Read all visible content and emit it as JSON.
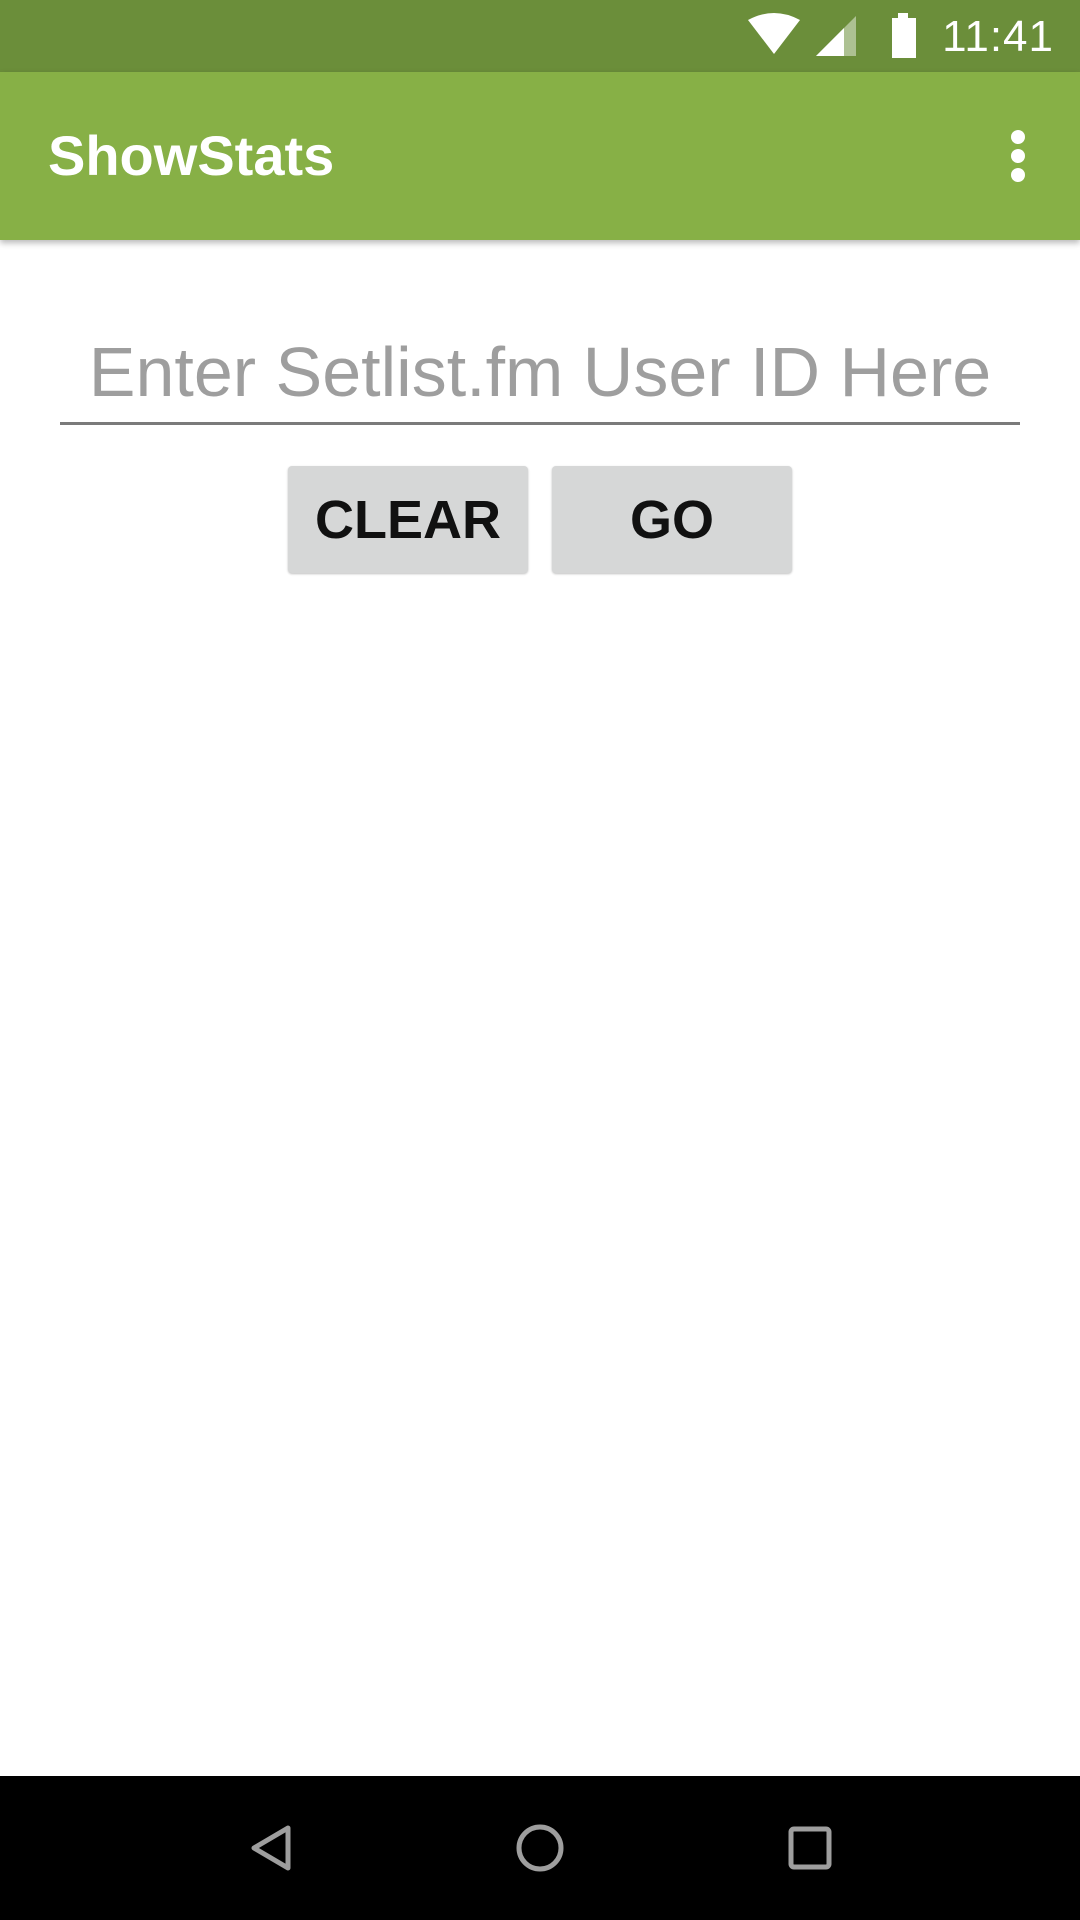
{
  "status_bar": {
    "time": "11:41",
    "icons": [
      "wifi-icon",
      "cell-signal-icon",
      "battery-icon"
    ]
  },
  "app_bar": {
    "title": "ShowStats",
    "menu_icon": "more-vert-icon"
  },
  "form": {
    "user_id_placeholder": "Enter Setlist.fm User ID Here",
    "user_id_value": "",
    "clear_label": "CLEAR",
    "go_label": "GO"
  },
  "nav_bar": {
    "icons": [
      "back-icon",
      "home-icon",
      "recents-icon"
    ]
  },
  "colors": {
    "status_bar": "#6b8e3a",
    "app_bar": "#87b046",
    "button_bg": "#d6d7d7",
    "nav_bar": "#000000"
  }
}
